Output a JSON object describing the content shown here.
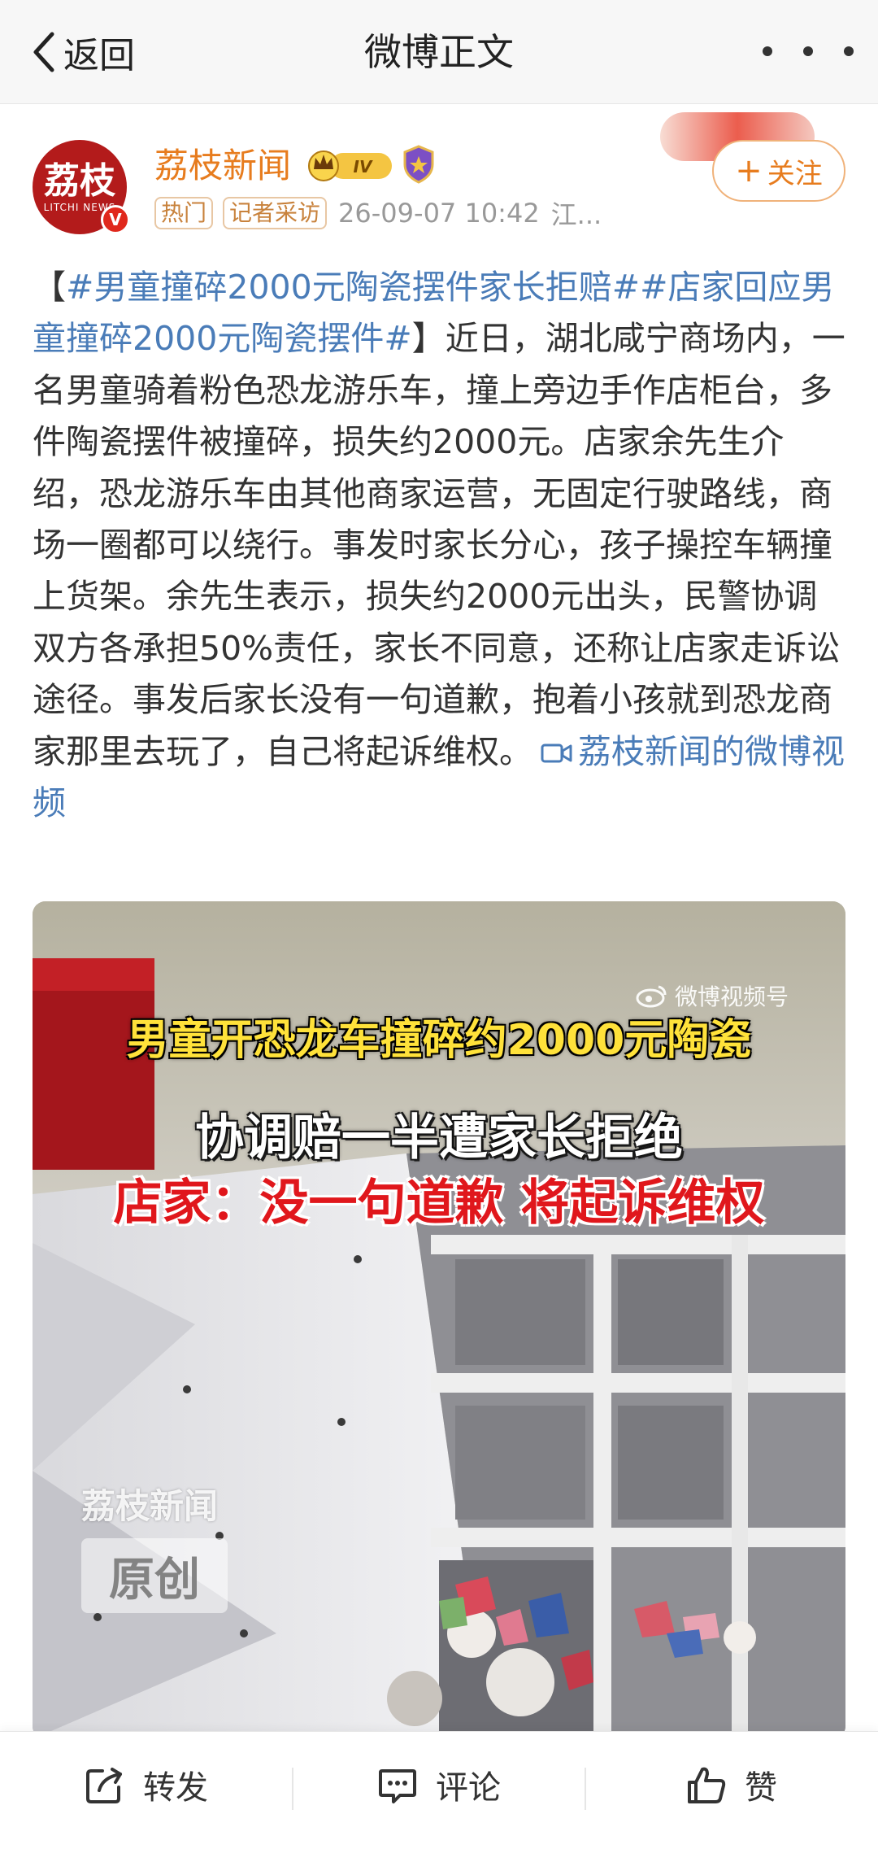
{
  "nav": {
    "back_label": "返回",
    "title": "微博正文"
  },
  "author": {
    "name": "荔枝新闻",
    "avatar_text": "荔枝",
    "avatar_sub": "LITCHI NEWS",
    "level_badge": "IV",
    "tags": [
      "热门",
      "记者采访"
    ],
    "time": "26-09-07 10:42",
    "location": "江...",
    "follow_label": "关注",
    "follow_plus": "+"
  },
  "post": {
    "hashtag_1": "#男童撞碎2000元陶瓷摆件家长拒赔#",
    "hashtag_2": "#店家回应男童撞碎2000元陶瓷摆件#",
    "open_bracket": "【",
    "close_bracket": "】",
    "body": "近日，湖北咸宁商场内，一名男童骑着粉色恐龙游乐车，撞上旁边手作店柜台，多件陶瓷摆件被撞碎，损失约2000元。店家余先生介绍，恐龙游乐车由其他商家运营，无固定行驶路线，商场一圈都可以绕行。事发时家长分心，孩子操控车辆撞上货架。余先生表示，损失约2000元出头，民警协调双方各承担50%责任，家长不同意，还称让店家走诉讼途径。事发后家长没有一句道歉，抱着小孩就到恐龙商家那里去玩了，自己将起诉维权。",
    "video_link": "荔枝新闻的微博视频"
  },
  "video": {
    "watermark_top": "微博视频号",
    "caption_1": "男童开恐龙车撞碎约2000元陶瓷",
    "caption_2": "协调赔一半遭家长拒绝",
    "caption_3": "店家：没一句道歉 将起诉维权",
    "watermark_name": "荔枝新闻",
    "watermark_box": "原创"
  },
  "toolbar": {
    "repost_label": "转发",
    "comment_label": "评论",
    "like_label": "赞"
  },
  "colors": {
    "accent_orange": "#e77c1e",
    "link_blue": "#4a7cb8",
    "avatar_red": "#b31b1b",
    "caption_yellow": "#ffe23a",
    "caption_red": "#e0171c"
  }
}
